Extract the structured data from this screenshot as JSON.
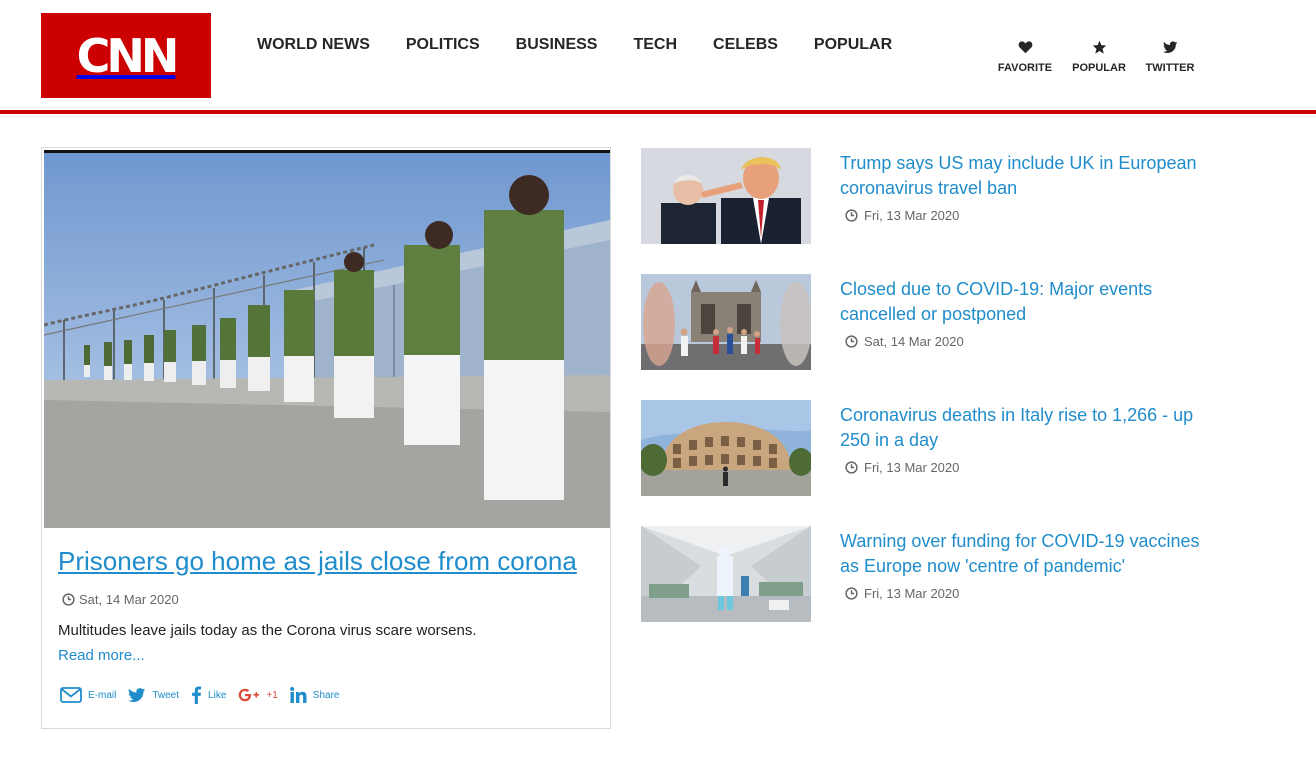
{
  "brand": {
    "logo_text": "CNN",
    "accent_color": "#cc0000",
    "link_color": "#1f8ccb"
  },
  "nav": {
    "items": [
      {
        "label": "WORLD NEWS"
      },
      {
        "label": "POLITICS"
      },
      {
        "label": "BUSINESS"
      },
      {
        "label": "TECH"
      },
      {
        "label": "CELEBS"
      },
      {
        "label": "POPULAR"
      }
    ]
  },
  "utility": {
    "items": [
      {
        "label": "FAVORITE",
        "icon": "heart-icon"
      },
      {
        "label": "POPULAR",
        "icon": "star-icon"
      },
      {
        "label": "TWITTER",
        "icon": "twitter-icon"
      }
    ]
  },
  "feature": {
    "image": "prisoners-walking-along-prison-fence",
    "title": "Prisoners go home as jails close from corona",
    "date": "Sat, 14 Mar 2020",
    "description": "Multitudes leave jails today as the Corona virus scare worsens.",
    "read_more": "Read more...",
    "share": [
      {
        "label": "E-mail",
        "icon": "email-icon"
      },
      {
        "label": "Tweet",
        "icon": "twitter-icon"
      },
      {
        "label": "Like",
        "icon": "facebook-icon"
      },
      {
        "label": "+1",
        "icon": "google-plus-icon"
      },
      {
        "label": "Share",
        "icon": "linkedin-icon"
      }
    ]
  },
  "stories": [
    {
      "title": "Trump says US may include UK in European coronavirus travel ban",
      "date": "Fri, 13 Mar 2020",
      "image": "trump-pointing-photo"
    },
    {
      "title": "Closed due to COVID-19: Major events cancelled or postponed",
      "date": "Sat, 14 Mar 2020",
      "image": "marathon-tower-bridge-photo"
    },
    {
      "title": "Coronavirus deaths in Italy rise to 1,266 - up 250 in a day",
      "date": "Fri, 13 Mar 2020",
      "image": "colosseum-photo"
    },
    {
      "title": "Warning over funding for COVID-19 vaccines as Europe now 'centre of pandemic'",
      "date": "Fri, 13 Mar 2020",
      "image": "medical-tent-photo"
    }
  ]
}
